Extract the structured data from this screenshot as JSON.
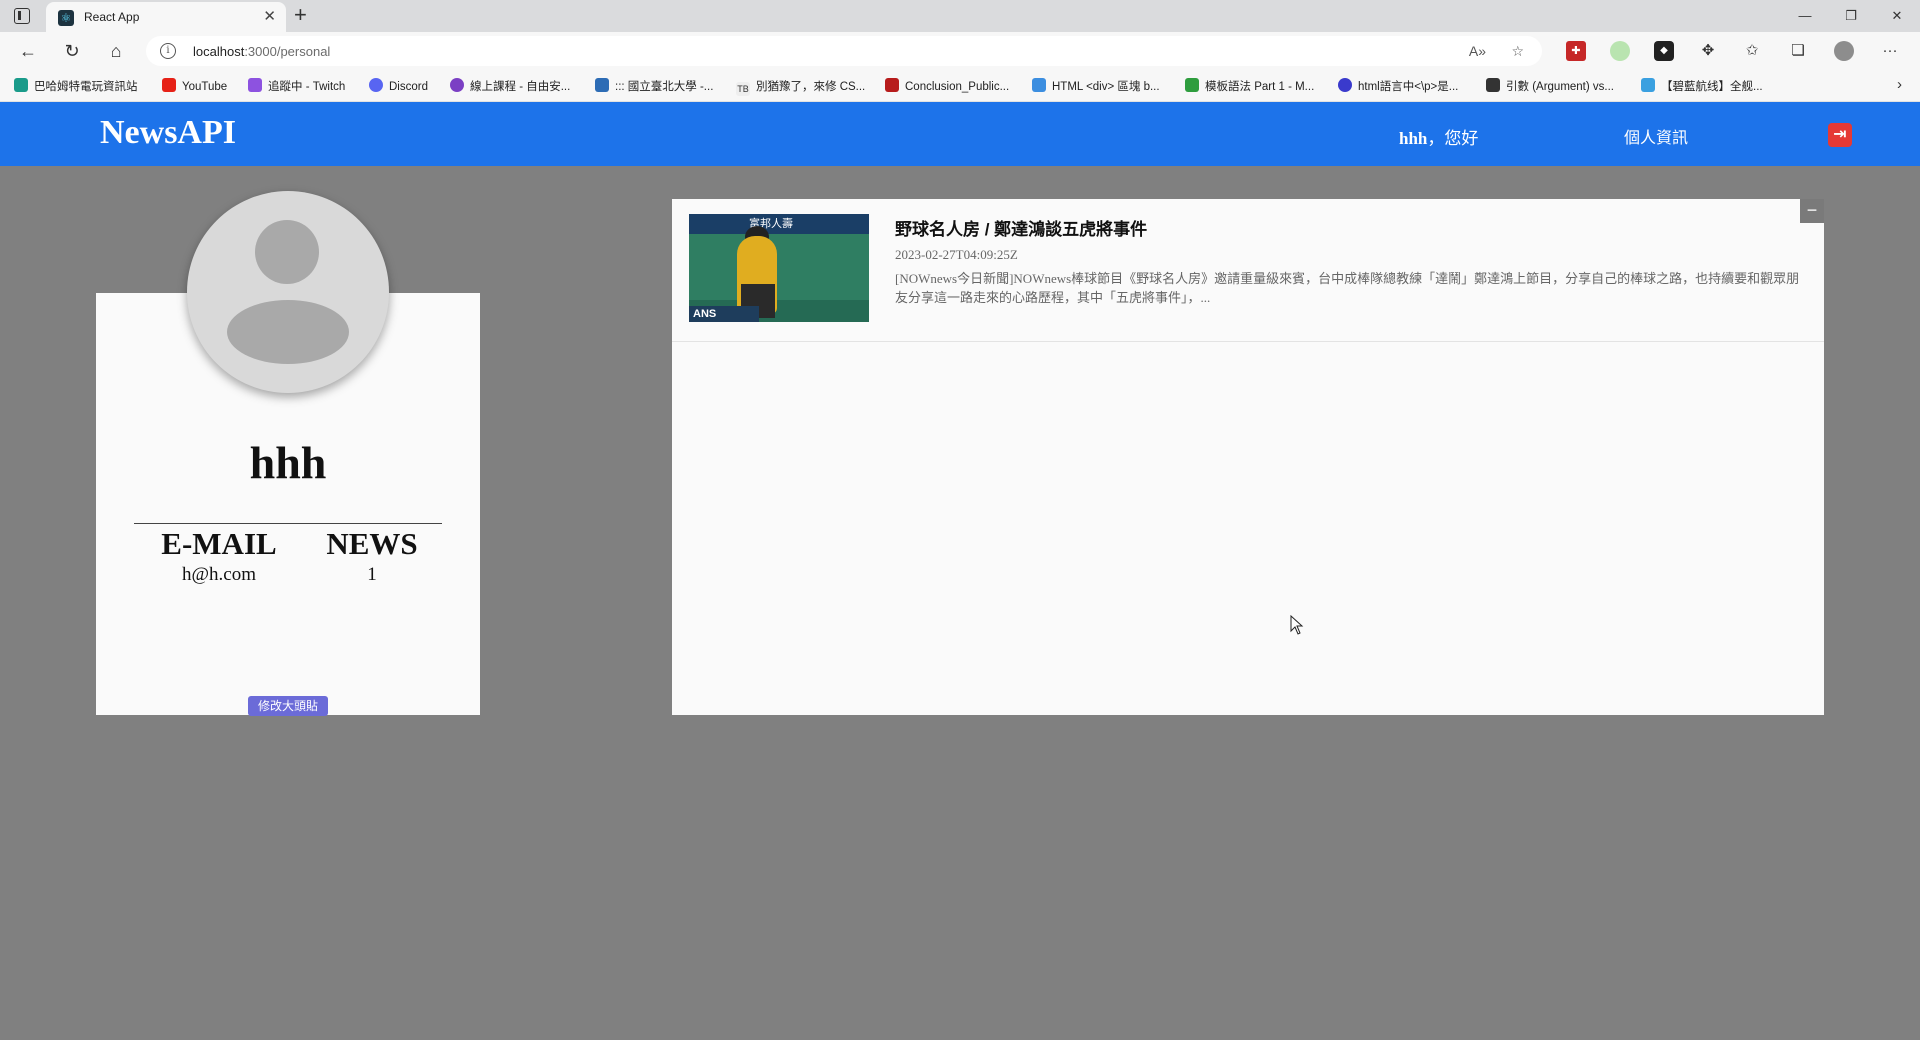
{
  "browser": {
    "tab_title": "React App",
    "tab_close": "✕",
    "new_tab": "+",
    "url_host": "localhost",
    "url_path": ":3000/personal",
    "window_controls": [
      "—",
      "❐",
      "✕"
    ],
    "bookmarks": [
      "巴哈姆特電玩資訊站",
      "YouTube",
      "追蹤中 - Twitch",
      "Discord",
      "線上課程 - 自由安...",
      "::: 國立臺北大學 -...",
      "別猶豫了，來修 CS...",
      "Conclusion_Public...",
      "HTML <div> 區塊 b...",
      "模板語法 Part 1 - M...",
      "html語言中<\\p>是...",
      "引數 (Argument) vs...",
      "【碧藍航线】全舰..."
    ]
  },
  "navbar": {
    "brand": "NewsAPI",
    "greeting_user": "hhh",
    "greeting_text": "，您好",
    "personal_link": "個人資訊",
    "logout_icon": "logout-icon"
  },
  "profile": {
    "username": "hhh",
    "email_label": "E-MAIL",
    "email_value": "h@h.com",
    "news_label": "NEWS",
    "news_value": "1",
    "edit_avatar_button": "修改大頭貼"
  },
  "news": {
    "collapse_label": "−",
    "items": [
      {
        "title": "野球名人房 / 鄭達鴻談五虎將事件",
        "date": "2023-02-27T04:09:25Z",
        "description": "[NOWnews今日新聞]NOWnews棒球節目《野球名人房》邀請重量級來賓，台中成棒隊總教練「達鬧」鄭達鴻上節目，分享自己的棒球之路，也持續要和觀眾朋友分享這一路走來的心路歷程，其中「五虎將事件」，...",
        "thumb_banner": "富邦人壽",
        "thumb_sign": "ANS"
      }
    ]
  }
}
